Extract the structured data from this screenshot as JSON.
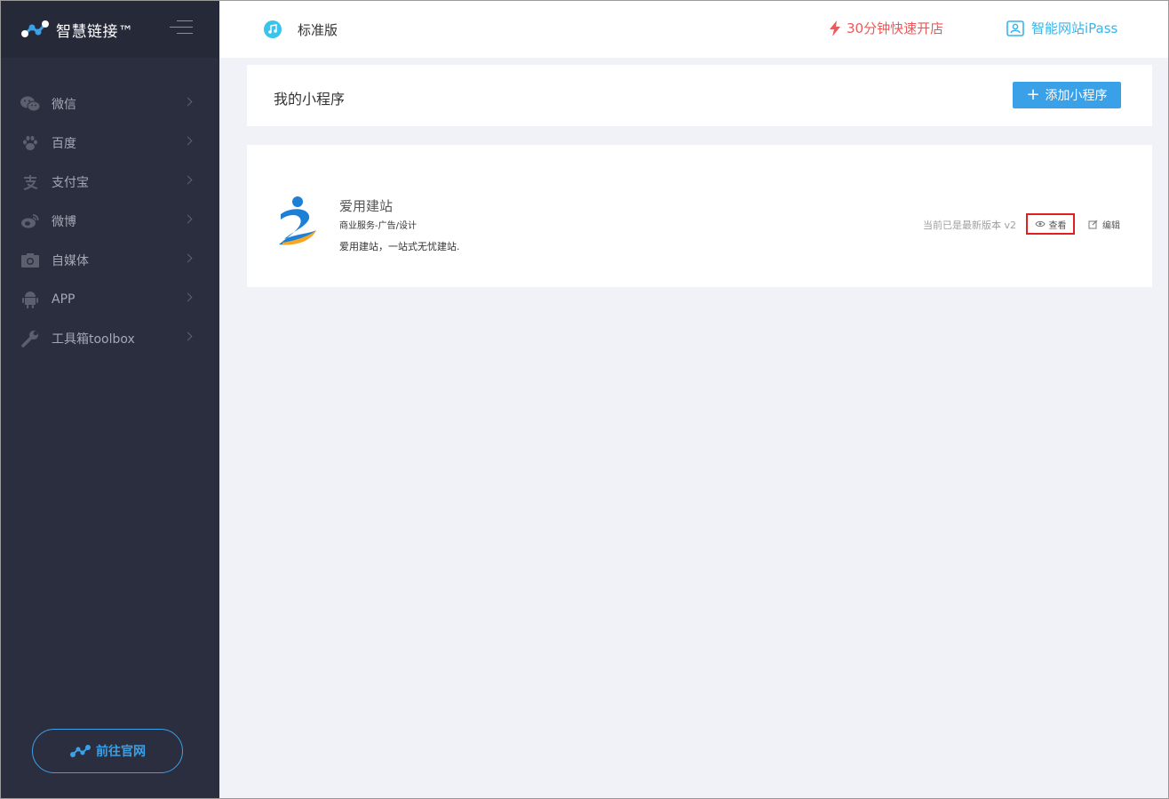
{
  "brand": {
    "name": "智慧链接™"
  },
  "sidebar": {
    "items": [
      {
        "label": "微信",
        "icon": "wechat-icon"
      },
      {
        "label": "百度",
        "icon": "paw-icon"
      },
      {
        "label": "支付宝",
        "icon": "alipay-icon"
      },
      {
        "label": "微博",
        "icon": "weibo-icon"
      },
      {
        "label": "自媒体",
        "icon": "camera-icon"
      },
      {
        "label": "APP",
        "icon": "android-icon"
      },
      {
        "label": "工具箱toolbox",
        "icon": "wrench-icon"
      }
    ],
    "site_button": "前往官网"
  },
  "header": {
    "edition": "标准版",
    "quick_open": "30分钟快速开店",
    "ipass": "智能网站iPass"
  },
  "main": {
    "title": "我的小程序",
    "add_button": "添加小程序",
    "apps": [
      {
        "name": "爱用建站",
        "category": "商业服务-广告/设计",
        "description": "爱用建站，一站式无忧建站.",
        "version": "当前已是最新版本 v2",
        "view_label": "查看",
        "edit_label": "编辑"
      }
    ]
  },
  "colors": {
    "sidebar_bg": "#2b2e3e",
    "accent": "#3aa0e8",
    "danger": "#ea5a5a",
    "highlight_border": "#e21e1e"
  }
}
